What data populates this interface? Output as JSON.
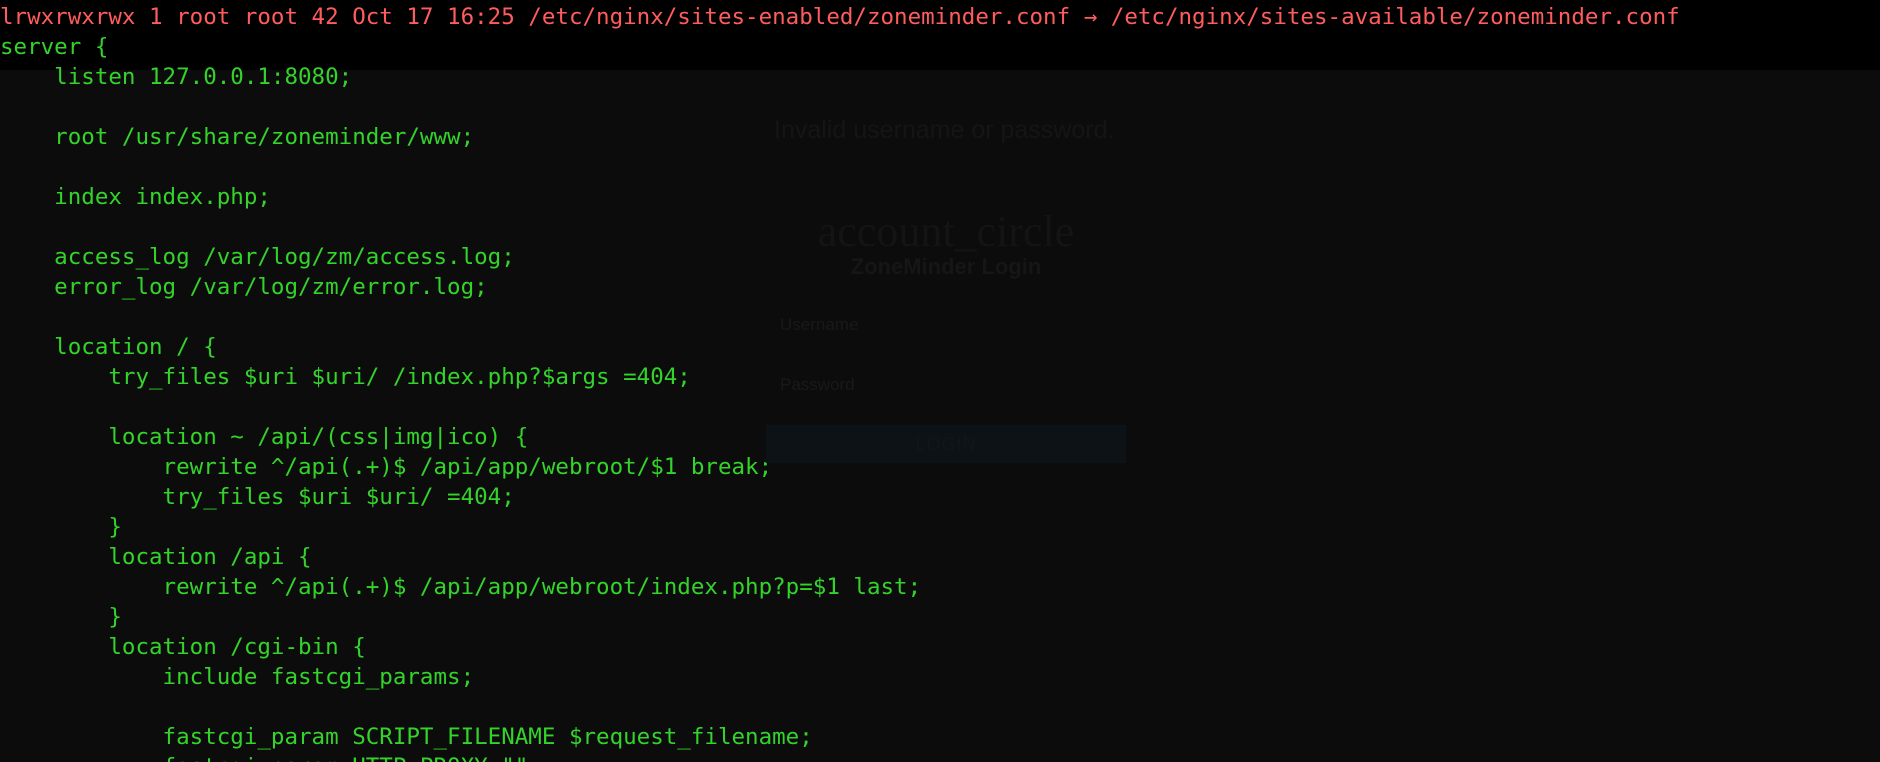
{
  "terminal": {
    "header": "lrwxrwxrwx 1 root root 42 Oct 17 16:25 /etc/nginx/sites-enabled/zoneminder.conf → /etc/nginx/sites-available/zoneminder.conf",
    "lines": [
      "server {",
      "    listen 127.0.0.1:8080;",
      "",
      "    root /usr/share/zoneminder/www;",
      "",
      "    index index.php;",
      "",
      "    access_log /var/log/zm/access.log;",
      "    error_log /var/log/zm/error.log;",
      "",
      "    location / {",
      "        try_files $uri $uri/ /index.php?$args =404;",
      "",
      "        location ~ /api/(css|img|ico) {",
      "            rewrite ^/api(.+)$ /api/app/webroot/$1 break;",
      "            try_files $uri $uri/ =404;",
      "        }",
      "        location /api {",
      "            rewrite ^/api(.+)$ /api/app/webroot/index.php?p=$1 last;",
      "        }",
      "        location /cgi-bin {",
      "            include fastcgi_params;",
      "",
      "            fastcgi_param SCRIPT_FILENAME $request_filename;",
      "            fastcgi_param HTTP_PROXY \"\";"
    ]
  },
  "login": {
    "error": "Invalid username or password.",
    "icon": "account_circle",
    "title": "ZoneMinder Login",
    "username_placeholder": "Username",
    "password_placeholder": "Password",
    "button_label": "LOGIN"
  },
  "colors": {
    "background": "#0c0c0c",
    "header_background": "#000000",
    "header_text": "#ff5c5c",
    "code_text": "#34d32b"
  }
}
